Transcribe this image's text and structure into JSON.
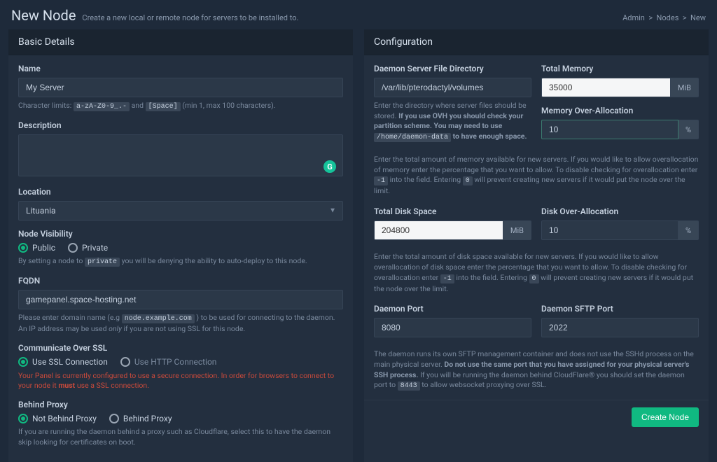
{
  "header": {
    "title": "New Node",
    "subtitle": "Create a new local or remote node for servers to be installed to."
  },
  "breadcrumb": {
    "admin": "Admin",
    "nodes": "Nodes",
    "current": "New"
  },
  "basic": {
    "panel_title": "Basic Details",
    "name": {
      "label": "Name",
      "value": "My Server",
      "help_prefix": "Character limits:",
      "code1": "a-zA-Z0-9_.-",
      "mid": "and",
      "code2": "[Space]",
      "help_suffix": "(min 1, max 100 characters)."
    },
    "description": {
      "label": "Description"
    },
    "location": {
      "label": "Location",
      "value": "Lituania"
    },
    "visibility": {
      "label": "Node Visibility",
      "public": "Public",
      "private": "Private",
      "help_prefix": "By setting a node to",
      "code": "private",
      "help_suffix": "you will be denying the ability to auto-deploy to this node."
    },
    "fqdn": {
      "label": "FQDN",
      "value": "gamepanel.space-hosting.net",
      "help_prefix": "Please enter domain name (e.g",
      "code": "node.example.com",
      "help_mid": ") to be used for connecting to the daemon. An IP address may be used",
      "em": "only",
      "help_suffix": "if you are not using SSL for this node."
    },
    "ssl": {
      "label": "Communicate Over SSL",
      "use_ssl": "Use SSL Connection",
      "use_http": "Use HTTP Connection",
      "warning_prefix": "Your Panel is currently configured to use a secure connection. In order for browsers to connect to your node it",
      "warning_strong": "must",
      "warning_suffix": "use a SSL connection."
    },
    "proxy": {
      "label": "Behind Proxy",
      "not_behind": "Not Behind Proxy",
      "behind": "Behind Proxy",
      "help": "If you are running the daemon behind a proxy such as Cloudflare, select this to have the daemon skip looking for certificates on boot."
    }
  },
  "config": {
    "panel_title": "Configuration",
    "daemon_dir": {
      "label": "Daemon Server File Directory",
      "value": "/var/lib/pterodactyl/volumes",
      "help_prefix": "Enter the directory where server files should be stored.",
      "strong": "If you use OVH you should check your partition scheme. You may need to use",
      "code": "/home/daemon-data",
      "strong2": "to have enough space."
    },
    "total_memory": {
      "label": "Total Memory",
      "value": "35000",
      "unit": "MiB"
    },
    "memory_over": {
      "label": "Memory Over-Allocation",
      "value": "10",
      "unit": "%"
    },
    "memory_help_prefix": "Enter the total amount of memory available for new servers. If you would like to allow overallocation of memory enter the percentage that you want to allow. To disable checking for overallocation enter",
    "memory_code1": "-1",
    "memory_help_mid": "into the field. Entering",
    "memory_code2": "0",
    "memory_help_suffix": "will prevent creating new servers if it would put the node over the limit.",
    "total_disk": {
      "label": "Total Disk Space",
      "value": "204800",
      "unit": "MiB"
    },
    "disk_over": {
      "label": "Disk Over-Allocation",
      "value": "10",
      "unit": "%"
    },
    "disk_help_prefix": "Enter the total amount of disk space available for new servers. If you would like to allow overallocation of disk space enter the percentage that you want to allow. To disable checking for overallocation enter",
    "disk_code1": "-1",
    "disk_help_mid": "into the field. Entering",
    "disk_code2": "0",
    "disk_help_suffix": "will prevent creating new servers if it would put the node over the limit.",
    "daemon_port": {
      "label": "Daemon Port",
      "value": "8080"
    },
    "sftp_port": {
      "label": "Daemon SFTP Port",
      "value": "2022"
    },
    "port_help_prefix": "The daemon runs its own SFTP management container and does not use the SSHd process on the main physical server.",
    "port_strong": "Do not use the same port that you have assigned for your physical server's SSH process.",
    "port_help_mid": "If you will be running the daemon behind CloudFlare® you should set the daemon port to",
    "port_code": "8443",
    "port_help_suffix": "to allow websocket proxying over SSL.",
    "submit": "Create Node"
  }
}
